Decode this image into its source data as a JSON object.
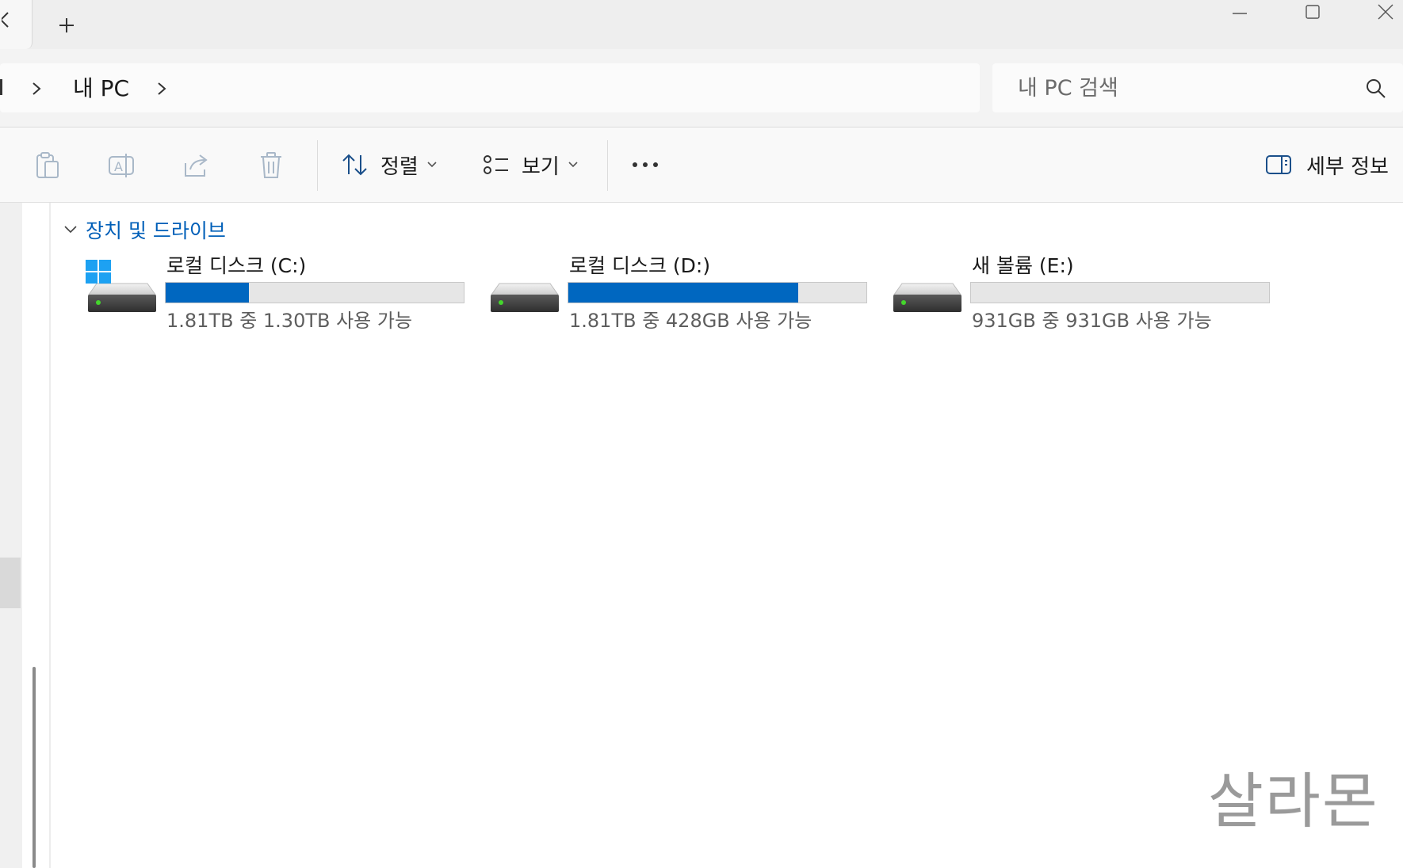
{
  "titlebar": {
    "new_tab_label": "+"
  },
  "address": {
    "breadcrumb": "내 PC"
  },
  "search": {
    "placeholder": "내 PC 검색"
  },
  "commands": {
    "sort_label": "정렬",
    "view_label": "보기",
    "more_label": "•••",
    "details_label": "세부 정보"
  },
  "group": {
    "title": "장치 및 드라이브"
  },
  "drives": [
    {
      "name": "로컬 디스크 (C:)",
      "space": "1.81TB 중 1.30TB 사용 가능",
      "used_fraction": 0.28,
      "system": true
    },
    {
      "name": "로컬 디스크 (D:)",
      "space": "1.81TB 중 428GB 사용 가능",
      "used_fraction": 0.77,
      "system": false
    },
    {
      "name": "새 볼륨 (E:)",
      "space": "931GB 중 931GB 사용 가능",
      "used_fraction": 0.0,
      "system": false
    }
  ],
  "watermark": "살라몬",
  "colors": {
    "accent": "#0067c0",
    "link": "#005fb8"
  }
}
